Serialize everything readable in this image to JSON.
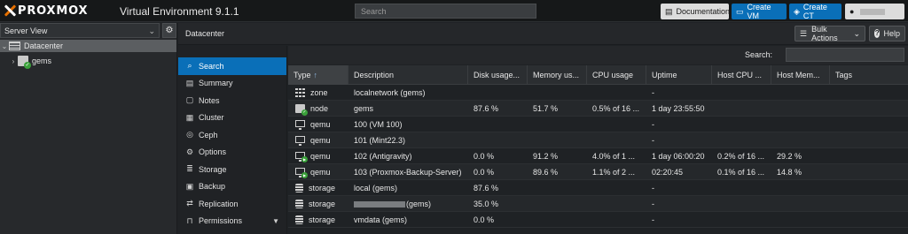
{
  "header": {
    "logo_text": "PROXMOX",
    "product": "Virtual Environment 9.1.1",
    "search_placeholder": "Search",
    "documentation_label": "Documentation",
    "create_vm_label": "Create VM",
    "create_ct_label": "Create CT"
  },
  "tree": {
    "view_label": "Server View",
    "items": [
      {
        "label": "Datacenter",
        "type": "datacenter",
        "selected": true
      },
      {
        "label": "gems",
        "type": "node"
      }
    ]
  },
  "content": {
    "title": "Datacenter",
    "bulk_actions_label": "Bulk Actions",
    "help_label": "Help",
    "search_label": "Search:"
  },
  "nav": [
    {
      "label": "Search",
      "icon": "search-icon",
      "active": true
    },
    {
      "label": "Summary",
      "icon": "book-icon"
    },
    {
      "label": "Notes",
      "icon": "notes-icon"
    },
    {
      "label": "Cluster",
      "icon": "server-icon"
    },
    {
      "label": "Ceph",
      "icon": "ceph-icon"
    },
    {
      "label": "Options",
      "icon": "gear-icon"
    },
    {
      "label": "Storage",
      "icon": "database-icon"
    },
    {
      "label": "Backup",
      "icon": "floppy-icon"
    },
    {
      "label": "Replication",
      "icon": "retweet-icon"
    },
    {
      "label": "Permissions",
      "icon": "unlock-icon",
      "expandable": true
    }
  ],
  "grid": {
    "columns": [
      "Type",
      "Description",
      "Disk usage...",
      "Memory us...",
      "CPU usage",
      "Uptime",
      "Host CPU ...",
      "Host Mem...",
      "Tags"
    ],
    "sorted_column": "Type",
    "rows": [
      {
        "type": "zone",
        "icon": "zone",
        "description": "localnetwork (gems)",
        "disk": "",
        "memory": "",
        "cpu": "",
        "uptime": "-",
        "host_cpu": "",
        "host_mem": "",
        "tags": ""
      },
      {
        "type": "node",
        "icon": "node",
        "description": "gems",
        "disk": "87.6 %",
        "memory": "51.7 %",
        "cpu": "0.5% of 16 ...",
        "uptime": "1 day 23:55:50",
        "host_cpu": "",
        "host_mem": "",
        "tags": ""
      },
      {
        "type": "qemu",
        "icon": "qemu",
        "description": "100 (VM 100)",
        "disk": "",
        "memory": "",
        "cpu": "",
        "uptime": "-",
        "host_cpu": "",
        "host_mem": "",
        "tags": ""
      },
      {
        "type": "qemu",
        "icon": "qemu",
        "description": "101 (Mint22.3)",
        "disk": "",
        "memory": "",
        "cpu": "",
        "uptime": "-",
        "host_cpu": "",
        "host_mem": "",
        "tags": ""
      },
      {
        "type": "qemu",
        "icon": "qemu-running",
        "description": "102 (Antigravity)",
        "disk": "0.0 %",
        "memory": "91.2 %",
        "cpu": "4.0% of 1 ...",
        "uptime": "1 day 06:00:20",
        "host_cpu": "0.2% of 16 ...",
        "host_mem": "29.2 %",
        "tags": ""
      },
      {
        "type": "qemu",
        "icon": "qemu-running",
        "description": "103 (Proxmox-Backup-Server)",
        "disk": "0.0 %",
        "memory": "89.6 %",
        "cpu": "1.1% of 2 ...",
        "uptime": "02:20:45",
        "host_cpu": "0.1% of 16 ...",
        "host_mem": "14.8 %",
        "tags": ""
      },
      {
        "type": "storage",
        "icon": "storage",
        "description": "local (gems)",
        "disk": "87.6 %",
        "memory": "",
        "cpu": "",
        "uptime": "-",
        "host_cpu": "",
        "host_mem": "",
        "tags": ""
      },
      {
        "type": "storage",
        "icon": "storage",
        "description": "(gems)",
        "redacted_prefix": true,
        "disk": "35.0 %",
        "memory": "",
        "cpu": "",
        "uptime": "-",
        "host_cpu": "",
        "host_mem": "",
        "tags": ""
      },
      {
        "type": "storage",
        "icon": "storage",
        "description": "vmdata (gems)",
        "disk": "0.0 %",
        "memory": "",
        "cpu": "",
        "uptime": "-",
        "host_cpu": "",
        "host_mem": "",
        "tags": ""
      }
    ]
  },
  "colors": {
    "accent": "#0a6fb8",
    "logo_orange": "#e57000",
    "status_green": "#3aa13a"
  }
}
